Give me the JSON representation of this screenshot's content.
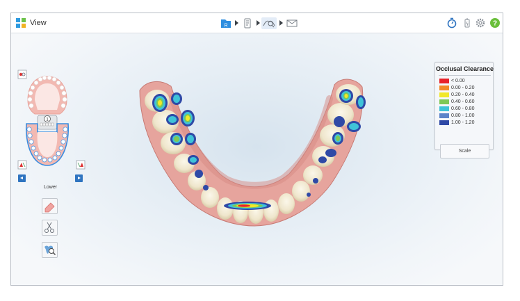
{
  "app": {
    "title": "View"
  },
  "workflow": {
    "steps": [
      "rx-icon",
      "scan-icon",
      "view-icon",
      "send-icon"
    ],
    "active": "view-icon"
  },
  "toolbar_right": [
    "timer-icon",
    "battery-icon",
    "settings-icon",
    "help-icon"
  ],
  "legend": {
    "title": "Occlusal Clearance",
    "rows": [
      {
        "label": "< 0.00",
        "color": "#e8222a"
      },
      {
        "label": "0.00 - 0.20",
        "color": "#f28a26"
      },
      {
        "label": "0.20 - 0.40",
        "color": "#f1e829"
      },
      {
        "label": "0.40 - 0.60",
        "color": "#7ec857"
      },
      {
        "label": "0.60 - 0.80",
        "color": "#3fc3d8"
      },
      {
        "label": "0.80 - 1.00",
        "color": "#5b83c9"
      },
      {
        "label": "1.00 - 1.20",
        "color": "#2f49a6"
      }
    ],
    "scale_label": "Scale"
  },
  "jaw_nav": {
    "arch_label": "Lower",
    "selected_tooth": "1"
  },
  "side_tools": [
    "eraser-tool",
    "trim-tool",
    "tooth-zoom-tool"
  ],
  "colors": {
    "accent": "#2f74c0",
    "gum": "#e7a9a3",
    "help": "#6abf3b"
  }
}
